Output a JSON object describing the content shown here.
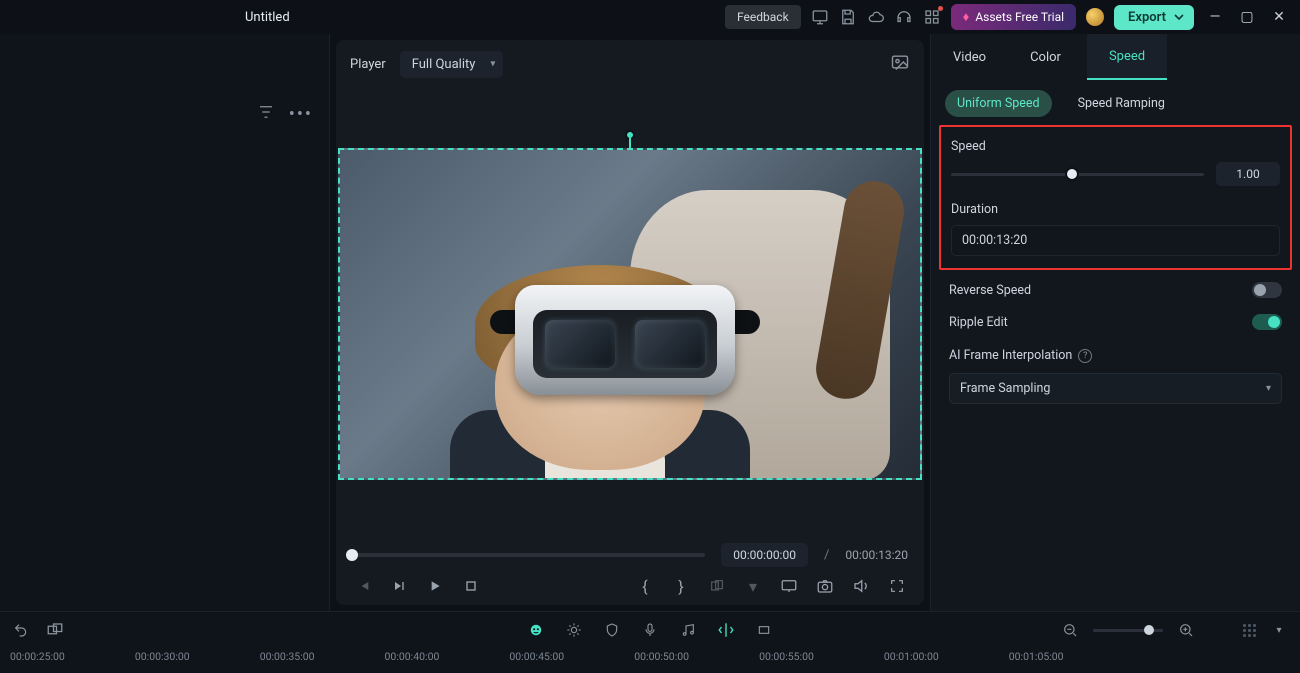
{
  "topbar": {
    "title": "Untitled",
    "feedback": "Feedback",
    "assets_trial": "Assets Free Trial",
    "export": "Export"
  },
  "player": {
    "label": "Player",
    "quality": "Full Quality",
    "progress_percent": 0,
    "current_tc": "00:00:00:00",
    "total_tc": "00:00:13:20"
  },
  "inspector": {
    "tabs": {
      "video": "Video",
      "color": "Color",
      "speed": "Speed"
    },
    "active_tab": "speed",
    "subtabs": {
      "uniform": "Uniform Speed",
      "ramping": "Speed Ramping"
    },
    "active_subtab": "uniform",
    "speed_label": "Speed",
    "speed_value": "1.00",
    "speed_percent": 48,
    "duration_label": "Duration",
    "duration_value": "00:00:13:20",
    "reverse_label": "Reverse Speed",
    "reverse_on": false,
    "ripple_label": "Ripple Edit",
    "ripple_on": true,
    "ai_label": "AI Frame Interpolation",
    "ai_mode": "Frame Sampling"
  },
  "timeline": {
    "ticks": [
      "00:00:25:00",
      "00:00:30:00",
      "00:00:35:00",
      "00:00:40:00",
      "00:00:45:00",
      "00:00:50:00",
      "00:00:55:00",
      "00:01:00:00",
      "00:01:05:00"
    ]
  }
}
